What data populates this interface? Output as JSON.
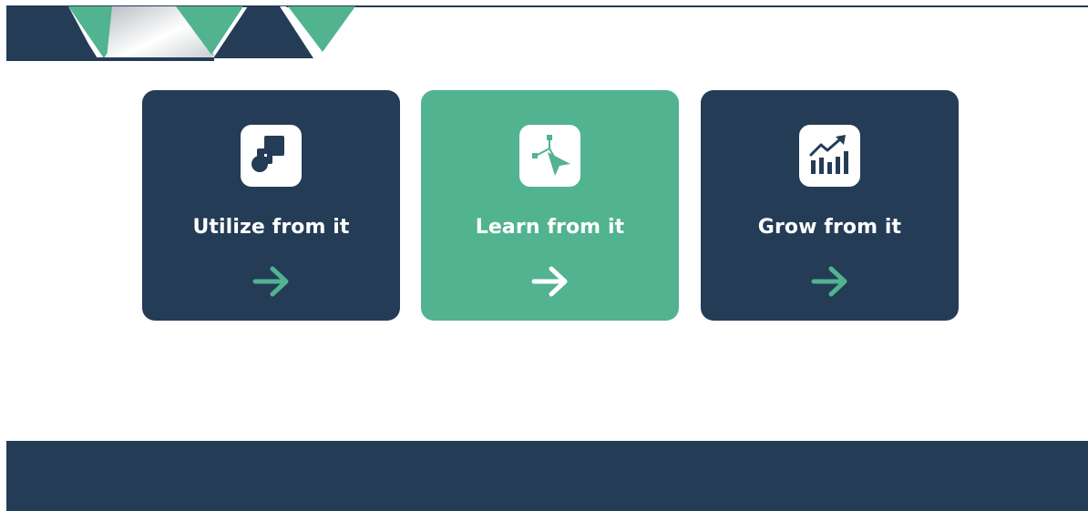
{
  "colors": {
    "navy": "#243c56",
    "green": "#51b38f",
    "white": "#ffffff"
  },
  "cards": [
    {
      "title": "Utilize from it",
      "icon": "shapes-icon",
      "style": "navy",
      "arrow_color": "green"
    },
    {
      "title": "Learn from it",
      "icon": "cursor-path-icon",
      "style": "green",
      "arrow_color": "white"
    },
    {
      "title": "Grow from it",
      "icon": "growth-chart-icon",
      "style": "navy",
      "arrow_color": "green"
    }
  ]
}
